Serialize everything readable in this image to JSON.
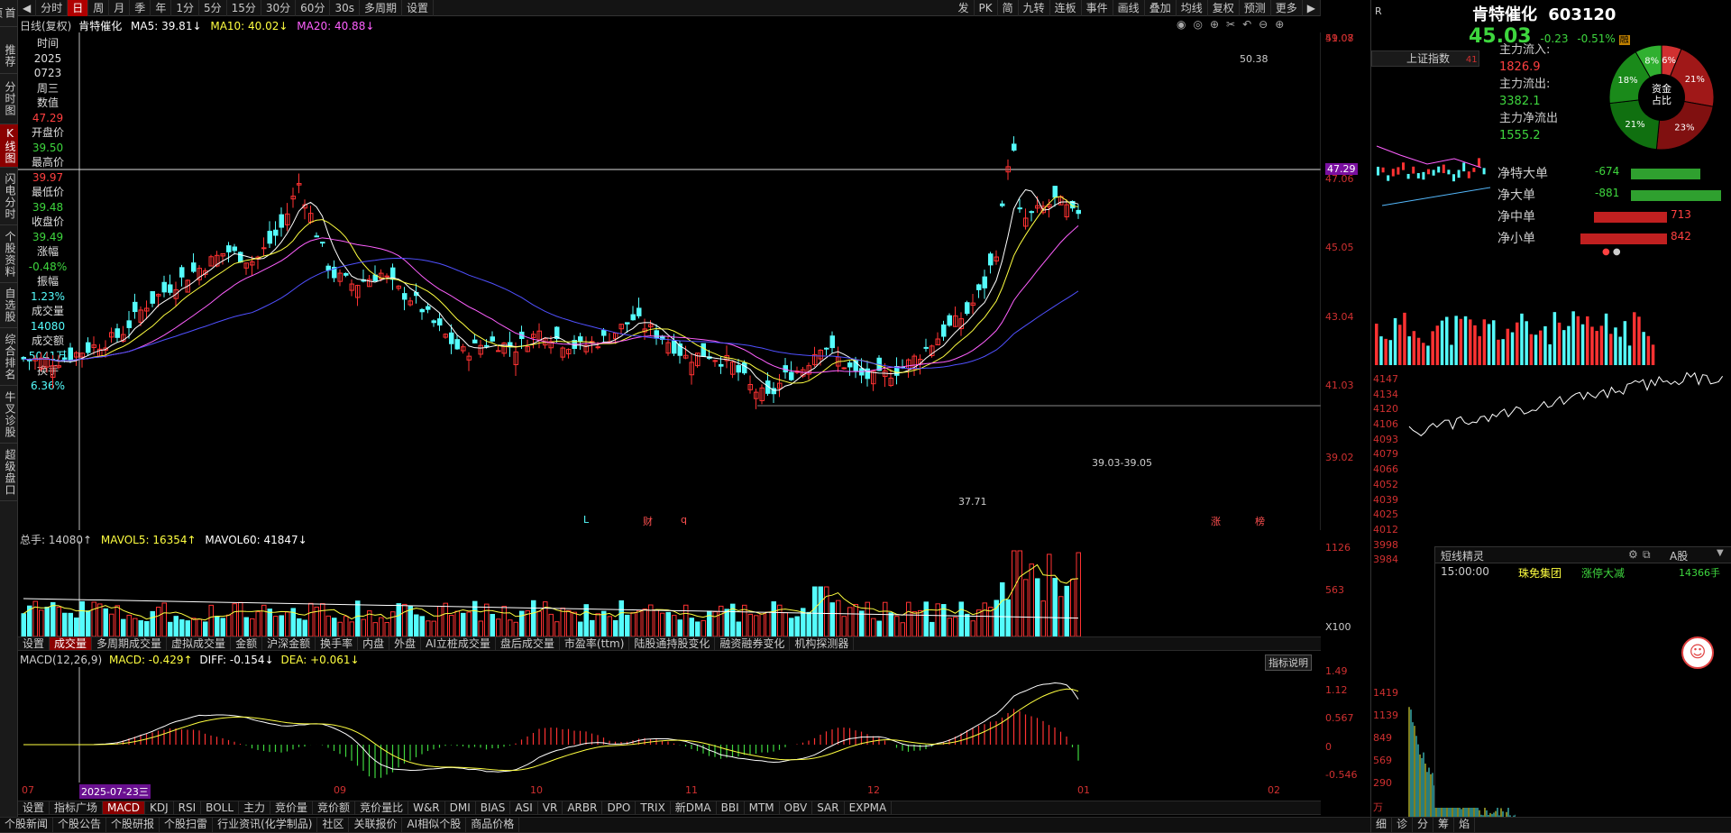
{
  "nav_left": [
    {
      "label": "首页",
      "active": false
    },
    {
      "label": "推荐",
      "active": false
    },
    {
      "label": "分时图",
      "active": false
    },
    {
      "label": "K线图",
      "active": true
    },
    {
      "label": "闪电分时",
      "active": false
    },
    {
      "label": "个股资料",
      "active": false
    },
    {
      "label": "自选股",
      "active": false
    },
    {
      "label": "综合排名",
      "active": false
    },
    {
      "label": "牛叉诊股",
      "active": false
    },
    {
      "label": "超级盘口",
      "active": false
    }
  ],
  "toolbar": {
    "periods": [
      "分时",
      "日",
      "周",
      "月",
      "季",
      "年",
      "1分",
      "5分",
      "15分",
      "30分",
      "60分",
      "30s",
      "多周期",
      "设置"
    ],
    "active_period": "日",
    "right_items": [
      "发",
      "PK",
      "简",
      "九转",
      "连板",
      "事件",
      "画线",
      "叠加",
      "均线",
      "复权",
      "预测",
      "更多"
    ]
  },
  "info_bar": {
    "mode": "日线(复权)",
    "stock": "肯特催化",
    "ma5": "MA5: 39.81↓",
    "ma10": "MA10: 40.02↓",
    "ma20": "MA20: 40.88↓"
  },
  "side_info": [
    {
      "label": "时间",
      "value": "2025"
    },
    {
      "label": "",
      "value": "0723"
    },
    {
      "label": "",
      "value": "周三"
    },
    {
      "label": "数值",
      "value": "47.29"
    },
    {
      "label": "开盘价",
      "value": "39.50"
    },
    {
      "label": "最高价",
      "value": "39.97"
    },
    {
      "label": "最低价",
      "value": "39.48"
    },
    {
      "label": "收盘价",
      "value": "39.49"
    },
    {
      "label": "涨幅",
      "value": "-0.48%"
    },
    {
      "label": "振幅",
      "value": "1.23%"
    },
    {
      "label": "成交量",
      "value": "14080"
    },
    {
      "label": "成交额",
      "value": "5041万"
    },
    {
      "label": "换手",
      "value": "6.36%"
    }
  ],
  "price_axis": [
    "51.08",
    "49.07",
    "47.29",
    "47.06",
    "45.05",
    "43.04",
    "41.03",
    "39.02"
  ],
  "chart_annotations": {
    "high": "50.38",
    "low": "37.71",
    "range": "39.03-39.05",
    "markers": [
      "L",
      "财",
      "q",
      "涨",
      "榜"
    ]
  },
  "volume_bar": {
    "total": "总手: 14080↑",
    "mavol5": "MAVOL5: 16354↑",
    "mavol60": "MAVOL60: 41847↓",
    "axis": [
      "1126",
      "563",
      "X100"
    ]
  },
  "indicator_tabs": [
    "设置",
    "成交量",
    "多周期成交量",
    "虚拟成交量",
    "金额",
    "沪深金额",
    "换手率",
    "内盘",
    "外盘",
    "AI立桩成交量",
    "盘后成交量",
    "市盈率(ttm)",
    "陆股通持股变化",
    "融资融券变化",
    "机构探测器"
  ],
  "macd_bar": {
    "name": "MACD(12,26,9)",
    "macd": "MACD: -0.429↑",
    "diff": "DIFF: -0.154↓",
    "dea": "DEA: +0.061↓",
    "explain": "指标说明",
    "axis": [
      "1.49",
      "1.12",
      "0.567",
      "0",
      "-0.546"
    ]
  },
  "date_axis": {
    "labels": [
      "07",
      "09",
      "10",
      "11",
      "12",
      "01",
      "02"
    ],
    "cursor": "2025-07-23三"
  },
  "bottom_tabs": [
    "设置",
    "指标广场",
    "MACD",
    "KDJ",
    "RSI",
    "BOLL",
    "主力",
    "竞价量",
    "竞价额",
    "竞价量比",
    "W&R",
    "DMI",
    "BIAS",
    "ASI",
    "VR",
    "ARBR",
    "DPO",
    "TRIX",
    "新DMA",
    "BBI",
    "MTM",
    "OBV",
    "SAR",
    "EXPMA"
  ],
  "news_tabs": [
    "个股新闻",
    "个股公告",
    "个股研报",
    "个股扫雷",
    "行业资讯(化学制品)",
    "社区",
    "关联报价",
    "AI相似个股",
    "商品价格"
  ],
  "right_panel": {
    "stock_name": "肯特催化",
    "stock_code": "603120",
    "price": "45.03",
    "change": "-0.23",
    "change_pct": "-0.51%",
    "index_tab": "上证指数",
    "index_sub": "41",
    "fund": [
      {
        "label": "主力流入:",
        "value": "1826.9"
      },
      {
        "label": "主力流出:",
        "value": "3382.1"
      },
      {
        "label": "主力净流出",
        "value": "1555.2"
      }
    ],
    "donut_center": "资金\n占比",
    "donut_slices": [
      {
        "label": "6%",
        "color": "#d03030",
        "value": 6
      },
      {
        "label": "21%",
        "color": "#a01818",
        "value": 21
      },
      {
        "label": "23%",
        "color": "#801010",
        "value": 23
      },
      {
        "label": "21%",
        "color": "#107010",
        "value": 21
      },
      {
        "label": "18%",
        "color": "#1a8a1a",
        "value": 18
      },
      {
        "label": "8%",
        "color": "#30b030",
        "value": 8
      }
    ],
    "flows": [
      {
        "label": "净特大单",
        "value": "-674",
        "color": "#2fa02f",
        "amount": 674
      },
      {
        "label": "净大单",
        "value": "-881",
        "color": "#2fa02f",
        "amount": 881
      },
      {
        "label": "净中单",
        "value": "713",
        "color": "#c02020",
        "amount": 713
      },
      {
        "label": "净小单",
        "value": "842",
        "color": "#c02020",
        "amount": 842
      }
    ],
    "index_axis": [
      "4147",
      "4134",
      "4120",
      "4106",
      "4093",
      "4079",
      "4066",
      "4052",
      "4039",
      "4025",
      "4012",
      "3998",
      "3984"
    ],
    "vol_axis": [
      "1419",
      "1139",
      "849",
      "569",
      "290",
      "万"
    ],
    "short_title": "短线精灵",
    "short_scope": "A股",
    "short_row": {
      "time": "15:00:00",
      "name": "珠免集团",
      "event": "涨停大减",
      "qty": "14366手"
    },
    "bottom_tabs": [
      "细",
      "诊",
      "分",
      "筹",
      "焰"
    ]
  }
}
